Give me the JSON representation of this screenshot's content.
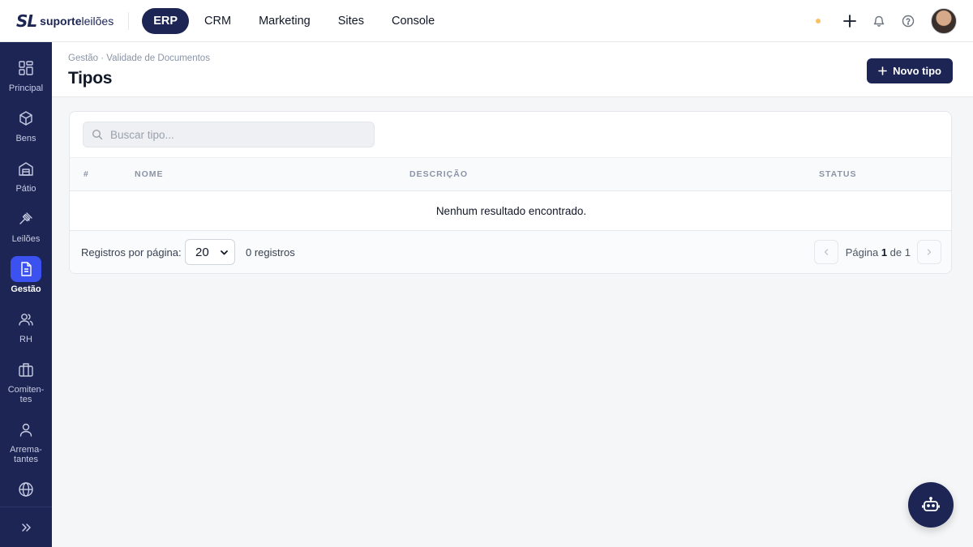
{
  "brand": {
    "mark": "SL",
    "name_bold": "suporte",
    "name_light": "leilões"
  },
  "topnav": [
    {
      "label": "ERP",
      "active": true
    },
    {
      "label": "CRM",
      "active": false
    },
    {
      "label": "Marketing",
      "active": false
    },
    {
      "label": "Sites",
      "active": false
    },
    {
      "label": "Console",
      "active": false
    }
  ],
  "top_actions": {
    "status_dot_color": "#fbbf66",
    "icons": [
      "plus-icon",
      "bell-icon",
      "help-icon"
    ]
  },
  "sidebar": {
    "items": [
      {
        "label": "Principal",
        "icon": "dashboard-icon",
        "active": false
      },
      {
        "label": "Bens",
        "icon": "box-icon",
        "active": false
      },
      {
        "label": "Pátio",
        "icon": "warehouse-icon",
        "active": false
      },
      {
        "label": "Leilões",
        "icon": "gavel-icon",
        "active": false
      },
      {
        "label": "Gestão",
        "icon": "document-icon",
        "active": true
      },
      {
        "label": "RH",
        "icon": "users-icon",
        "active": false
      },
      {
        "label": "Comiten-tes",
        "icon": "briefcase-icon",
        "active": false
      },
      {
        "label": "Arrema-tantes",
        "icon": "user-icon",
        "active": false
      },
      {
        "label": "",
        "icon": "globe-icon",
        "active": false
      }
    ],
    "collapse_icon": "chevrons-right-icon"
  },
  "header": {
    "breadcrumb": "Gestão · Validade de Documentos",
    "title": "Tipos",
    "new_button": "Novo tipo"
  },
  "search": {
    "placeholder": "Buscar tipo...",
    "value": ""
  },
  "table": {
    "columns": [
      "#",
      "NOME",
      "DESCRIÇÃO",
      "STATUS"
    ],
    "rows": [],
    "empty_message": "Nenhum resultado encontrado."
  },
  "footer": {
    "per_page_label": "Registros por página:",
    "per_page_value": "20",
    "record_count": "0 registros",
    "page_prefix": "Página",
    "page_current": "1",
    "page_of": "de",
    "page_total": "1"
  },
  "colors": {
    "navy": "#1c2554",
    "accent": "#3b52f0"
  }
}
